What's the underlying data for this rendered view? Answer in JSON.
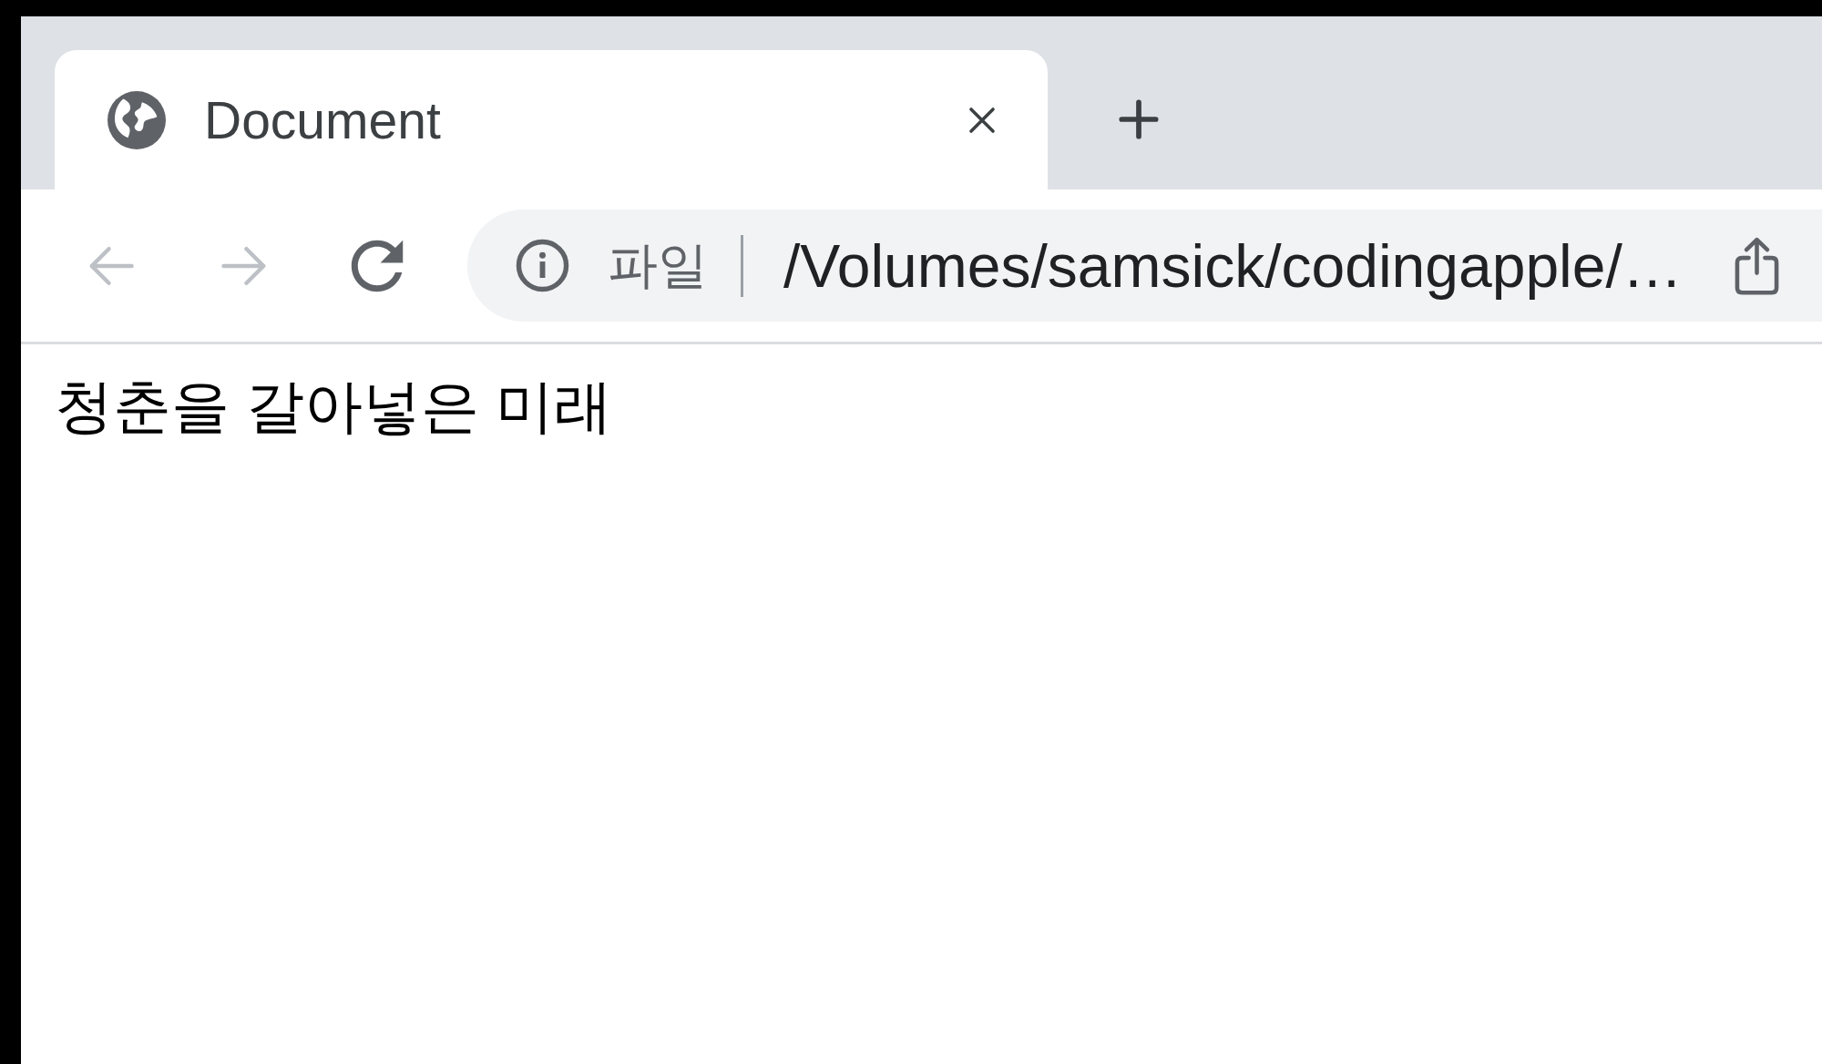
{
  "tabs": [
    {
      "title": "Document",
      "selected": true
    }
  ],
  "nav_buttons": [
    {
      "kind": "back",
      "disabled": true
    },
    {
      "kind": "forward",
      "disabled": true
    },
    {
      "kind": "reload",
      "disabled": false
    }
  ],
  "address_bar": {
    "scheme_label": "파일",
    "url": "/Volumes/samsick/codingapple/…"
  },
  "page": {
    "text": "청춘을 갈아넣은 미래"
  }
}
